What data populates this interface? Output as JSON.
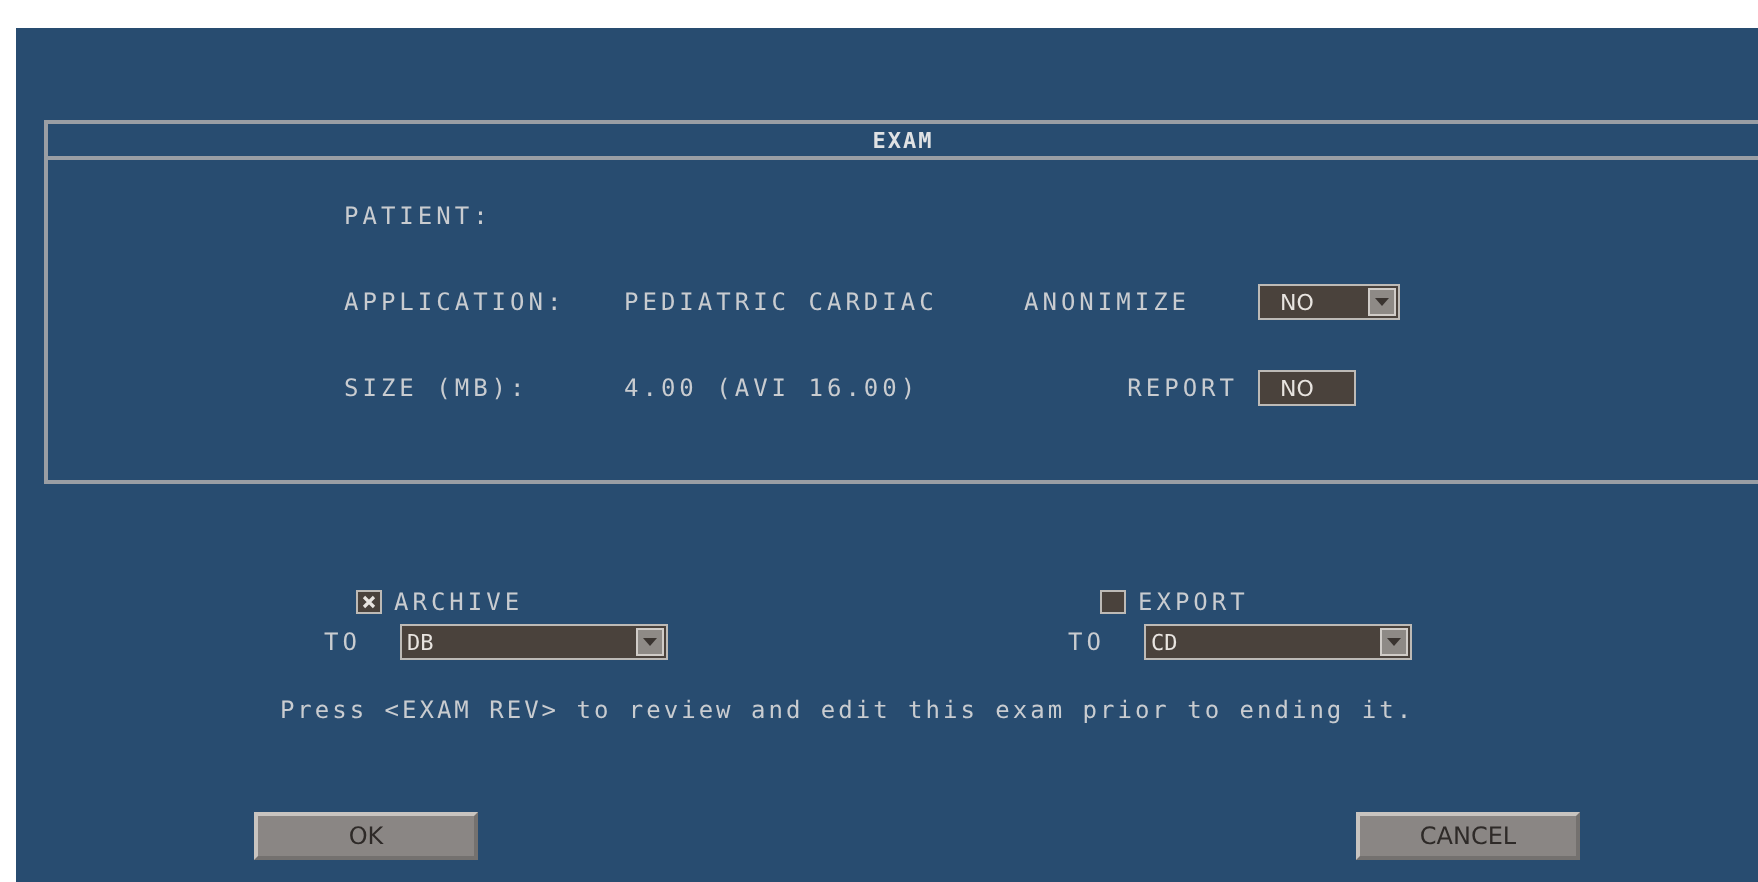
{
  "panel": {
    "title": "EXAM",
    "rows": [
      {
        "label": "PATIENT:"
      },
      {
        "label": "APPLICATION:",
        "value": "PEDIATRIC CARDIAC",
        "option_label": "ANONIMIZE",
        "option_value": "NO",
        "kind": "dropdown"
      },
      {
        "label": "SIZE (MB):",
        "value": "4.00 (AVI 16.00)",
        "option_label": "REPORT",
        "option_value": "NO",
        "kind": "box"
      }
    ]
  },
  "destinations": [
    {
      "label": "ARCHIVE",
      "checked": true,
      "to_label": "TO",
      "target": "DB"
    },
    {
      "label": "EXPORT",
      "checked": false,
      "to_label": "TO",
      "target": "CD"
    }
  ],
  "message": "Press <EXAM REV> to review and edit this exam prior to ending it.",
  "buttons": [
    "OK",
    "CANCEL"
  ]
}
